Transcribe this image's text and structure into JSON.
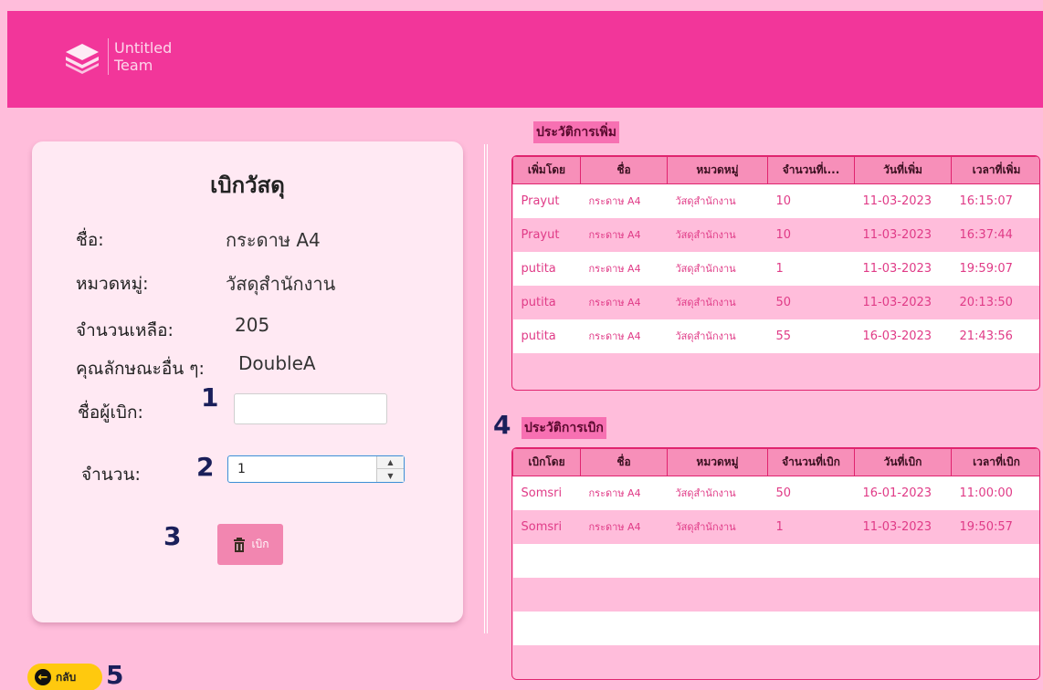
{
  "brand": {
    "line1": "Untitled",
    "line2": "Team"
  },
  "form": {
    "title": "เบิกวัสดุ",
    "fields": [
      {
        "label": "ชื่อ:",
        "value": "กระดาษ A4"
      },
      {
        "label": "หมวดหมู่:",
        "value": "วัสดุสำนักงาน"
      },
      {
        "label": "จำนวนเหลือ:",
        "value": "205"
      },
      {
        "label": "คุณลักษณะอื่น ๆ:",
        "value": "DoubleA"
      }
    ],
    "requester_label": "ชื่อผู้เบิก:",
    "requester_value": "",
    "quantity_label": "จำนวน:",
    "quantity_value": "1",
    "withdraw_button": "เบิก"
  },
  "markers": {
    "m1": "1",
    "m2": "2",
    "m3": "3",
    "m4": "4",
    "m5": "5"
  },
  "add_history": {
    "title": "ประวัติการเพิ่ม",
    "columns": [
      "เพิ่มโดย",
      "ชื่อ",
      "หมวดหมู่",
      "จำนวนที่เ...",
      "วันที่เพิ่ม",
      "เวลาที่เพิ่ม"
    ],
    "rows": [
      [
        "Prayut",
        "กระดาษ A4",
        "วัสดุสำนักงาน",
        "10",
        "11-03-2023",
        "16:15:07"
      ],
      [
        "Prayut",
        "กระดาษ A4",
        "วัสดุสำนักงาน",
        "10",
        "11-03-2023",
        "16:37:44"
      ],
      [
        "putita",
        "กระดาษ A4",
        "วัสดุสำนักงาน",
        "1",
        "11-03-2023",
        "19:59:07"
      ],
      [
        "putita",
        "กระดาษ A4",
        "วัสดุสำนักงาน",
        "50",
        "11-03-2023",
        "20:13:50"
      ],
      [
        "putita",
        "กระดาษ A4",
        "วัสดุสำนักงาน",
        "55",
        "16-03-2023",
        "21:43:56"
      ]
    ]
  },
  "withdraw_history": {
    "title": "ประวัติการเบิก",
    "columns": [
      "เบิกโดย",
      "ชื่อ",
      "หมวดหมู่",
      "จำนวนที่เบิก",
      "วันที่เบิก",
      "เวลาที่เบิก"
    ],
    "rows": [
      [
        "Somsri",
        "กระดาษ A4",
        "วัสดุสำนักงาน",
        "50",
        "16-01-2023",
        "11:00:00"
      ],
      [
        "Somsri",
        "กระดาษ A4",
        "วัสดุสำนักงาน",
        "1",
        "11-03-2023",
        "19:50:57"
      ]
    ]
  },
  "back_button": "กลับ",
  "colors": {
    "header": "#f2369a",
    "background": "#ffbddb",
    "accent": "#e03b87",
    "back": "#ffc90e"
  }
}
